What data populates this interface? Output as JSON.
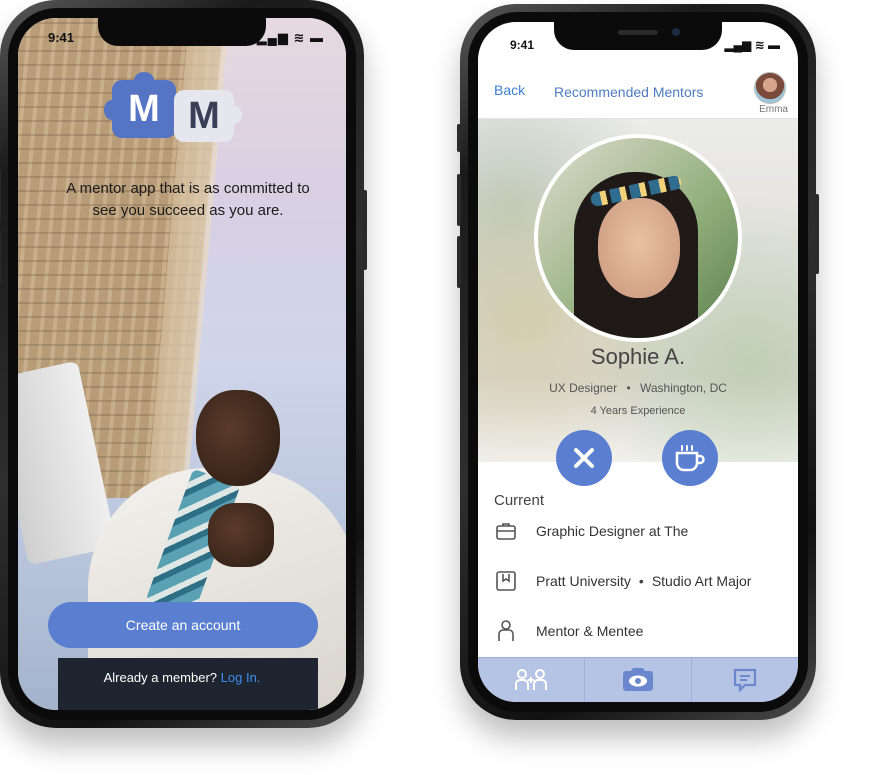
{
  "left_phone": {
    "status_time": "9:41",
    "status_icons": "▂▄▆ ≋ ▬",
    "logo_letters": [
      "M",
      "M"
    ],
    "tagline": "A mentor app that is as committed to see you succeed as you are.",
    "create_account_label": "Create an account",
    "member_prompt": "Already a member?",
    "login_link": "Log In."
  },
  "right_phone": {
    "status_time": "9:41",
    "status_icons": "▂▄▆ ≋ ▬",
    "back_label": "Back",
    "title": "Recommended Mentors",
    "user_name": "Emma",
    "mentor": {
      "name": "Sophie A.",
      "role": "UX Designer",
      "dot": "•",
      "location": "Washington, DC",
      "experience": "4 Years Experience"
    },
    "section_title": "Current",
    "details": [
      {
        "icon": "briefcase-icon",
        "text": "Graphic Designer at The"
      },
      {
        "icon": "bookmark-icon",
        "text": "Pratt University",
        "extra": "Studio Art Major"
      },
      {
        "icon": "person-icon",
        "text": "Mentor & Mentee"
      }
    ],
    "tabs": [
      {
        "icon": "add-connection-icon"
      },
      {
        "icon": "discover-eye-icon"
      },
      {
        "icon": "messages-icon"
      }
    ]
  },
  "colors": {
    "accent": "#5a7ed0",
    "link": "#3c8ff0",
    "tabbar": "#b5c4e4"
  }
}
